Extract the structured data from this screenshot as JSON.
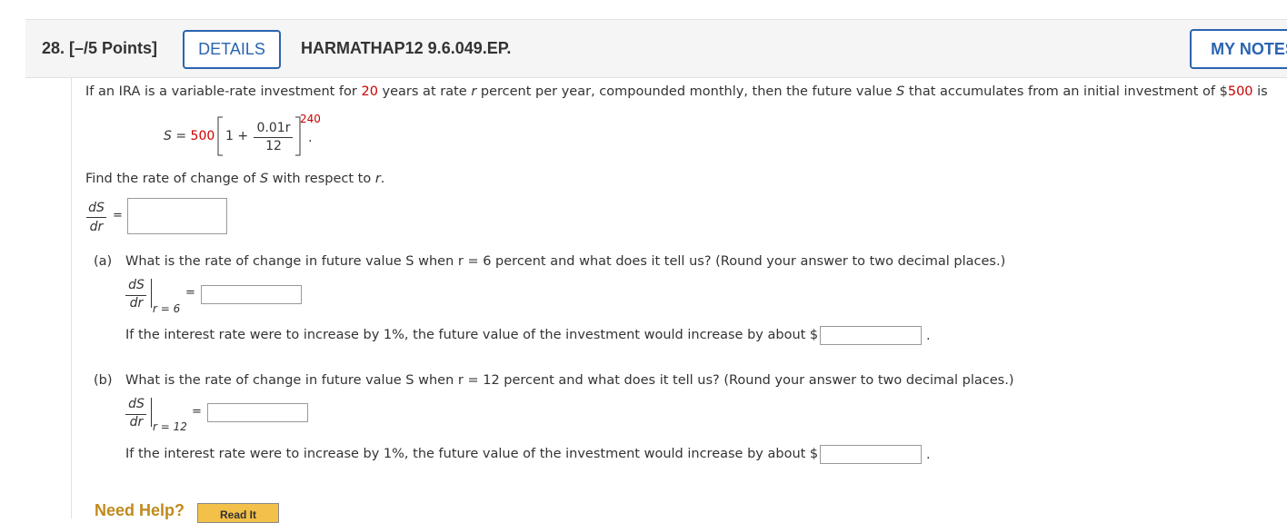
{
  "header": {
    "question_label": "28. [–/5 Points]",
    "details_label": "DETAILS",
    "code": "HARMATHAP12 9.6.049.EP.",
    "my_notes_label": "MY NOTES"
  },
  "problem": {
    "intro_1": "If an IRA is a variable-rate investment for ",
    "years": "20",
    "intro_2": " years at rate ",
    "r": "r",
    "intro_3": " percent per year, compounded monthly, then the future value ",
    "S": "S",
    "intro_4": " that accumulates from an initial investment of $",
    "principal": "500",
    "intro_5": " is",
    "formula": {
      "lhs": "S",
      "equals": "=",
      "principal": "500",
      "one_plus": "1 +",
      "numerator": "0.01r",
      "denominator": "12",
      "exponent": "240",
      "period": "."
    },
    "find_1": "Find the rate of change of ",
    "find_S": "S",
    "find_2": " with respect to ",
    "find_r": "r",
    "find_3": ".",
    "dS": "dS",
    "dr": "dr",
    "equals": "="
  },
  "part_a": {
    "letter": "(a)",
    "question": "What is the rate of change in future value S when r = 6 percent and what does it tell us? (Round your answer to two decimal places.)",
    "eval_at": "r = 6",
    "increase_text": "If the interest rate were to increase by 1%, the future value of the investment would increase by about $",
    "period": "."
  },
  "part_b": {
    "letter": "(b)",
    "question": "What is the rate of change in future value S when r = 12 percent and what does it tell us? (Round your answer to two decimal places.)",
    "eval_at": "r = 12",
    "increase_text": "If the interest rate were to increase by 1%, the future value of the investment would increase by about $",
    "period": "."
  },
  "help": {
    "label": "Need Help?",
    "read_it": "Read It"
  },
  "colors": {
    "accent": "#2a64b0",
    "highlight": "#cc0000",
    "help": "#c08a1c",
    "read_it_bg": "#f3c04a"
  }
}
